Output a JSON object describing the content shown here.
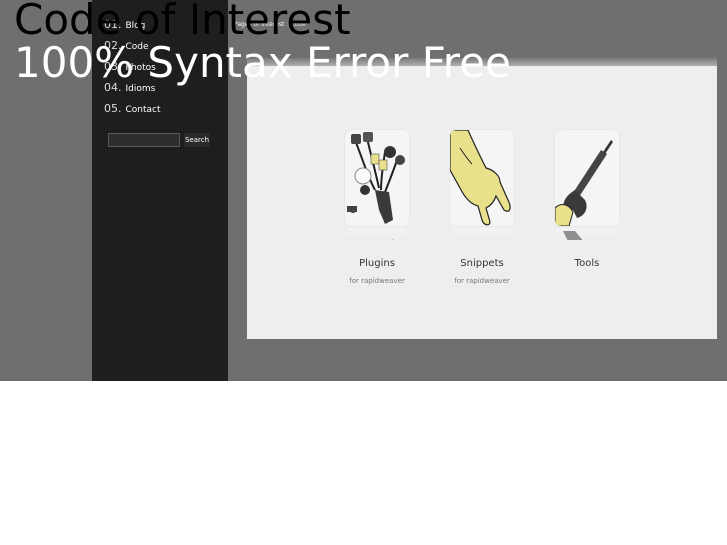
{
  "site": {
    "title": "Code of Interest",
    "subtitle": "100% Syntax Error Free"
  },
  "nav": [
    {
      "num": "01.",
      "label": "Blog"
    },
    {
      "num": "02.",
      "label": "Code"
    },
    {
      "num": "03.",
      "label": "Photos"
    },
    {
      "num": "04.",
      "label": "Idioms"
    },
    {
      "num": "05.",
      "label": "Contact"
    }
  ],
  "search": {
    "value": "",
    "button_label": "Search"
  },
  "breadcrumb": {
    "parent": "Pages of Interest",
    "separator": ":",
    "current": "Code"
  },
  "tiles": [
    {
      "label": "Plugins",
      "sub": "for rapidweaver",
      "icon": "plugin-cables-icon"
    },
    {
      "label": "Snippets",
      "sub": "for rapidweaver",
      "icon": "pointing-hand-icon"
    },
    {
      "label": "Tools",
      "sub": "",
      "icon": "screwdriver-wrench-icon"
    }
  ],
  "colors": {
    "background_band": "#6f6f6f",
    "sidebar": "#1e1e1e",
    "panel": "#eeeeee",
    "hand_yellow": "#e8e08a"
  }
}
